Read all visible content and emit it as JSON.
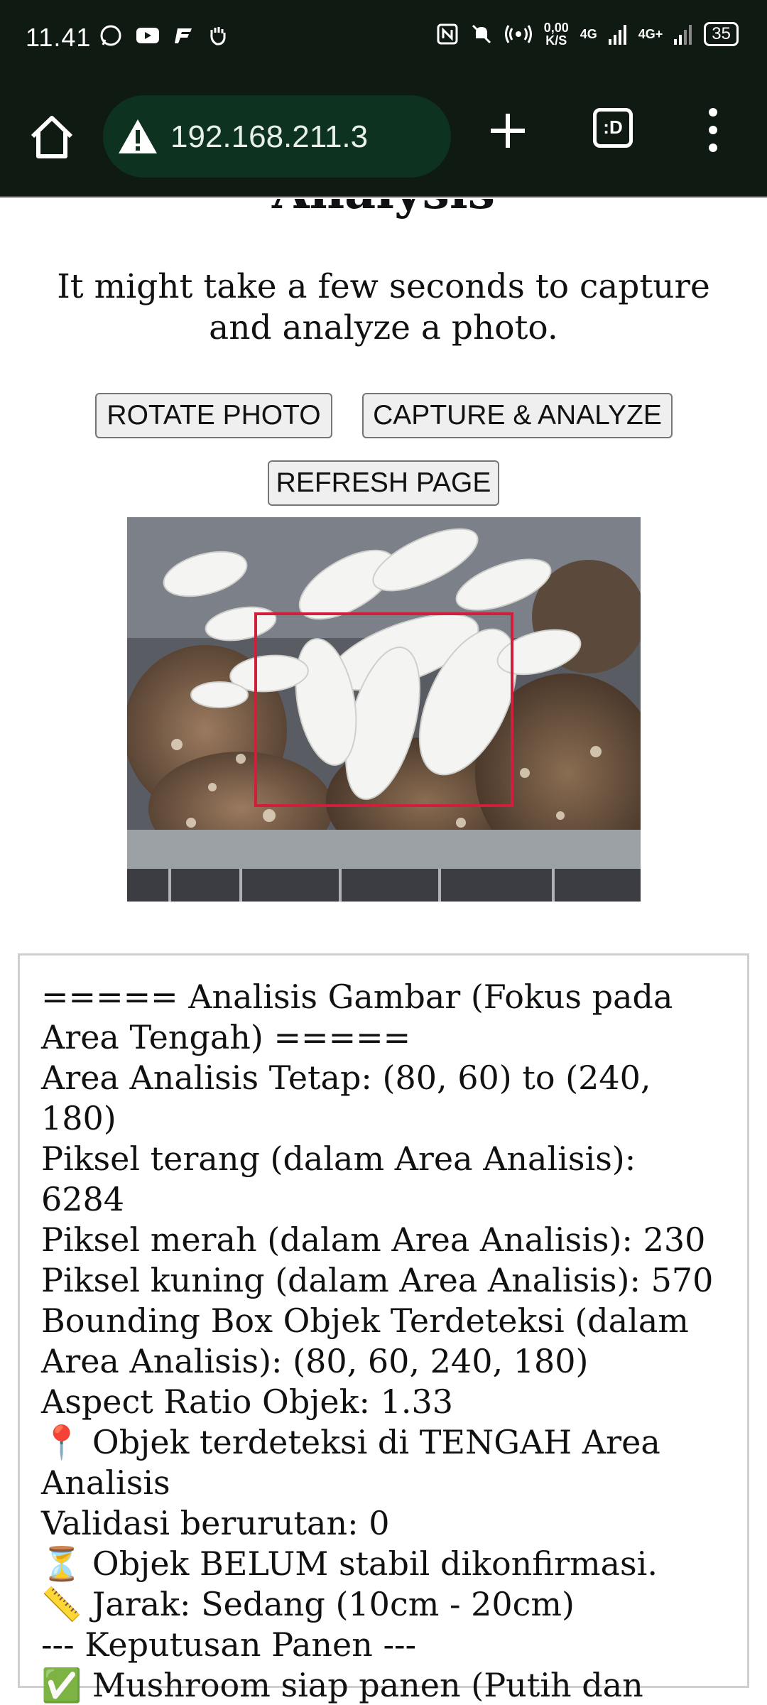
{
  "status_bar": {
    "time": "11.41",
    "net_speed_value": "0,00",
    "net_speed_unit": "K/S",
    "net1": "4G",
    "net2": "4G+",
    "battery": "35",
    "left_icons": [
      "whatsapp-icon",
      "youtube-icon",
      "app-f-icon",
      "hand-icon"
    ],
    "right_icons": [
      "nfc-icon",
      "mute-icon",
      "hotspot-icon",
      "signal-icon",
      "signal-icon",
      "battery-icon"
    ]
  },
  "browser": {
    "url": "192.168.211.3",
    "tabs_label": ":D",
    "icons": [
      "home-icon",
      "warning-icon",
      "plus-icon",
      "tabs-icon",
      "menu-icon"
    ]
  },
  "page": {
    "title": "Analysis",
    "subtitle": "It might take a few seconds to capture and analyze a photo.",
    "buttons": {
      "rotate": "ROTATE PHOTO",
      "capture": "CAPTURE & ANALYZE",
      "refresh": "REFRESH PAGE"
    }
  },
  "results": {
    "lines": [
      "===== Analisis Gambar (Fokus pada Area Tengah) =====",
      "Area Analisis Tetap: (80, 60) to (240, 180)",
      "Piksel terang (dalam Area Analisis): 6284",
      "Piksel merah (dalam Area Analisis): 230",
      "Piksel kuning (dalam Area Analisis): 570",
      "Bounding Box Objek Terdeteksi (dalam Area Analisis): (80, 60, 240, 180)",
      "Aspect Ratio Objek: 1.33",
      "📍 Objek terdeteksi di TENGAH Area Analisis",
      "Validasi berurutan: 0",
      "⏳ Objek BELUM stabil dikonfirmasi.",
      "📏 Jarak: Sedang (10cm - 20cm)",
      "--- Keputusan Panen ---",
      "✅ Mushroom siap panen (Putih dan besar)"
    ]
  }
}
